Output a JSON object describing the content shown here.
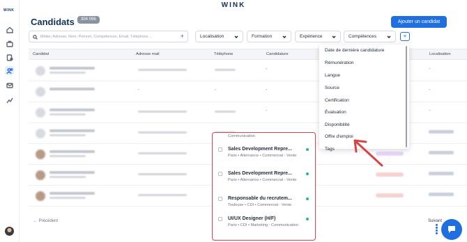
{
  "app": {
    "brand": "WINK",
    "rail_logo": "WINK"
  },
  "rail": {
    "icons": [
      "home-icon",
      "briefcase-icon",
      "document-user-icon",
      "candidates-icon",
      "mail-icon",
      "chart-icon"
    ],
    "active": "candidates-icon"
  },
  "header": {
    "title": "Candidats",
    "count": "304 096",
    "add_button": "Ajouter un candidat"
  },
  "search": {
    "placeholder": "Métier, Adresse, Nom, Prénom, Compétences, Email, Téléphone ..."
  },
  "filters": [
    {
      "label": "Localisation"
    },
    {
      "label": "Formation"
    },
    {
      "label": "Expérience"
    },
    {
      "label": "Compétences"
    }
  ],
  "table": {
    "columns": [
      "Candidat",
      "Adresse mail",
      "Téléphone",
      "Candidature",
      "Localisation"
    ],
    "dash": "-"
  },
  "pagination": {
    "prev": "← Précédent",
    "next": "Suivant"
  },
  "column_menu": {
    "items": [
      "Date de dernière candidature",
      "Rémunération",
      "Langue",
      "Source",
      "Certification",
      "Évaluation",
      "Disponibilité",
      "Offre d'emploi",
      "Tags"
    ]
  },
  "job_popup": {
    "top_text": "Communication",
    "jobs": [
      {
        "title": "Sales Development Repre...",
        "meta": "Paris • Alternance • Commercial - Vente"
      },
      {
        "title": "Sales Development Repre...",
        "meta": "Paris • Alternance • Commercial - Vente"
      },
      {
        "title": "Responsable du recrutem...",
        "meta": "Toulouse • CDI • Commercial - Vente"
      },
      {
        "title": "UI/UX Designer (H/F)",
        "meta": "Paris • CDI • Marketing - Communication"
      }
    ]
  },
  "colors": {
    "accent": "#1f6fe0",
    "annotation": "#d64545",
    "status_dot": "#2fb67c"
  }
}
